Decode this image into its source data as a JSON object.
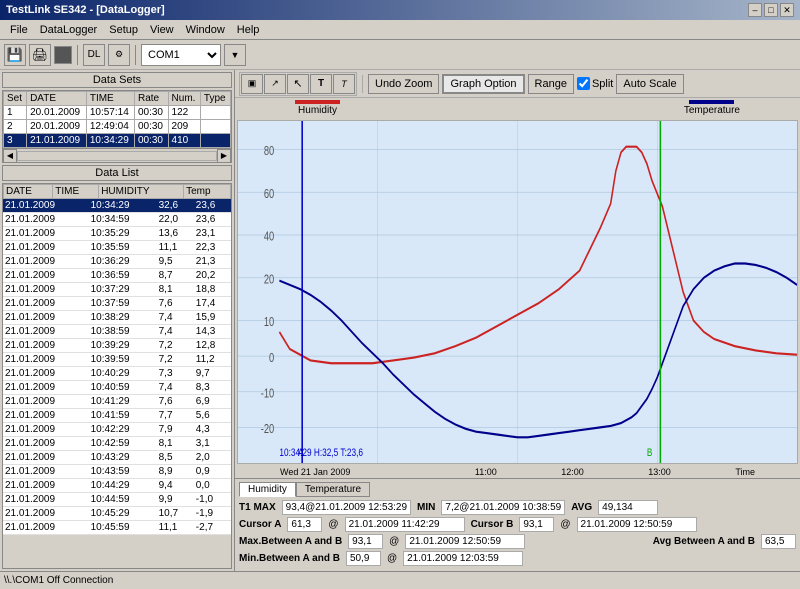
{
  "titlebar": {
    "title": "TestLink SE342 - [DataLogger]",
    "minimize": "–",
    "maximize": "□",
    "close": "✕",
    "inner_minimize": "_",
    "inner_restore": "▪",
    "inner_close": "✕"
  },
  "menu": {
    "items": [
      "File",
      "DataLogger",
      "Setup",
      "View",
      "Window",
      "Help"
    ]
  },
  "toolbar": {
    "com_port": "COM1",
    "buttons": [
      "💾",
      "🖨️",
      "⬛",
      "📥",
      "⚙️",
      "🖥️"
    ]
  },
  "graph_toolbar": {
    "undo_zoom": "Undo Zoom",
    "graph_option": "Graph Option",
    "range": "Range",
    "split": "Split",
    "auto_scale": "Auto Scale"
  },
  "datasets": {
    "header": "Data Sets",
    "columns": [
      "Set",
      "DATE",
      "TIME",
      "Rate",
      "Num.",
      "Type"
    ],
    "rows": [
      {
        "set": "1",
        "date": "20.01.2009",
        "time": "10:57:14",
        "rate": "00:30",
        "num": "122",
        "type": ""
      },
      {
        "set": "2",
        "date": "20.01.2009",
        "time": "12:49:04",
        "rate": "00:30",
        "num": "209",
        "type": ""
      },
      {
        "set": "3",
        "date": "21.01.2009",
        "time": "10:34:29",
        "rate": "00:30",
        "num": "410",
        "type": "",
        "selected": true
      }
    ]
  },
  "datalist": {
    "header": "Data List",
    "columns": [
      "DATE",
      "TIME",
      "HUMIDITY",
      "Temp"
    ],
    "rows": [
      {
        "date": "21.01.2009",
        "time": "10:34:29",
        "humidity": "32,6",
        "temp": "23,6",
        "selected": true
      },
      {
        "date": "21.01.2009",
        "time": "10:34:59",
        "humidity": "22,0",
        "temp": "23,6"
      },
      {
        "date": "21.01.2009",
        "time": "10:35:29",
        "humidity": "13,6",
        "temp": "23,1"
      },
      {
        "date": "21.01.2009",
        "time": "10:35:59",
        "humidity": "11,1",
        "temp": "22,3"
      },
      {
        "date": "21.01.2009",
        "time": "10:36:29",
        "humidity": "9,5",
        "temp": "21,3"
      },
      {
        "date": "21.01.2009",
        "time": "10:36:59",
        "humidity": "8,7",
        "temp": "20,2"
      },
      {
        "date": "21.01.2009",
        "time": "10:37:29",
        "humidity": "8,1",
        "temp": "18,8"
      },
      {
        "date": "21.01.2009",
        "time": "10:37:59",
        "humidity": "7,6",
        "temp": "17,4"
      },
      {
        "date": "21.01.2009",
        "time": "10:38:29",
        "humidity": "7,4",
        "temp": "15,9"
      },
      {
        "date": "21.01.2009",
        "time": "10:38:59",
        "humidity": "7,4",
        "temp": "14,3"
      },
      {
        "date": "21.01.2009",
        "time": "10:39:29",
        "humidity": "7,2",
        "temp": "12,8"
      },
      {
        "date": "21.01.2009",
        "time": "10:39:59",
        "humidity": "7,2",
        "temp": "11,2"
      },
      {
        "date": "21.01.2009",
        "time": "10:40:29",
        "humidity": "7,3",
        "temp": "9,7"
      },
      {
        "date": "21.01.2009",
        "time": "10:40:59",
        "humidity": "7,4",
        "temp": "8,3"
      },
      {
        "date": "21.01.2009",
        "time": "10:41:29",
        "humidity": "7,6",
        "temp": "6,9"
      },
      {
        "date": "21.01.2009",
        "time": "10:41:59",
        "humidity": "7,7",
        "temp": "5,6"
      },
      {
        "date": "21.01.2009",
        "time": "10:42:29",
        "humidity": "7,9",
        "temp": "4,3"
      },
      {
        "date": "21.01.2009",
        "time": "10:42:59",
        "humidity": "8,1",
        "temp": "3,1"
      },
      {
        "date": "21.01.2009",
        "time": "10:43:29",
        "humidity": "8,5",
        "temp": "2,0"
      },
      {
        "date": "21.01.2009",
        "time": "10:43:59",
        "humidity": "8,9",
        "temp": "0,9"
      },
      {
        "date": "21.01.2009",
        "time": "10:44:29",
        "humidity": "9,4",
        "temp": "0,0"
      },
      {
        "date": "21.01.2009",
        "time": "10:44:59",
        "humidity": "9,9",
        "temp": "-1,0"
      },
      {
        "date": "21.01.2009",
        "time": "10:45:29",
        "humidity": "10,7",
        "temp": "-1,9"
      },
      {
        "date": "21.01.2009",
        "time": "10:45:59",
        "humidity": "11,1",
        "temp": "-2,7"
      }
    ]
  },
  "graph": {
    "humidity_label": "Humidity",
    "temperature_label": "Temperature",
    "x_axis_label": "Time",
    "date_label": "Wed 21 Jan 2009",
    "x_ticks": [
      "11:00",
      "12:00",
      "13:00"
    ],
    "y_ticks": [
      "-20",
      "-10",
      "0",
      "10",
      "20",
      "40",
      "60",
      "80"
    ],
    "cursor_line_label": "10:34:29 H:32,5 T:23,6"
  },
  "stats": {
    "tabs": [
      "Humidity",
      "Temperature"
    ],
    "active_tab": "Humidity",
    "t1_max_label": "T1 MAX",
    "t1_max_value": "93,4@21.01.2009 12:53:29",
    "t1_min_label": "MIN",
    "t1_min_value": "7,2@21.01.2009 10:38:59",
    "t1_avg_label": "AVG",
    "t1_avg_value": "49,134",
    "cursor_a_label": "Cursor A",
    "cursor_a_value": "61,3",
    "cursor_a_time": "21.01.2009 11:42:29",
    "cursor_b_label": "Cursor B",
    "cursor_b_value": "93,1",
    "cursor_b_time": "21.01.2009 12:50:59",
    "max_between_label": "Max.Between A and B",
    "max_between_value": "93,1",
    "max_between_time": "21.01.2009 12:50:59",
    "min_between_label": "Min.Between A and B",
    "min_between_value": "50,9",
    "min_between_time": "21.01.2009 12:03:59",
    "avg_between_label": "Avg Between A and B",
    "avg_between_value": "63,5"
  },
  "statusbar": {
    "text": "\\\\.\\COM1  Off Connection"
  }
}
